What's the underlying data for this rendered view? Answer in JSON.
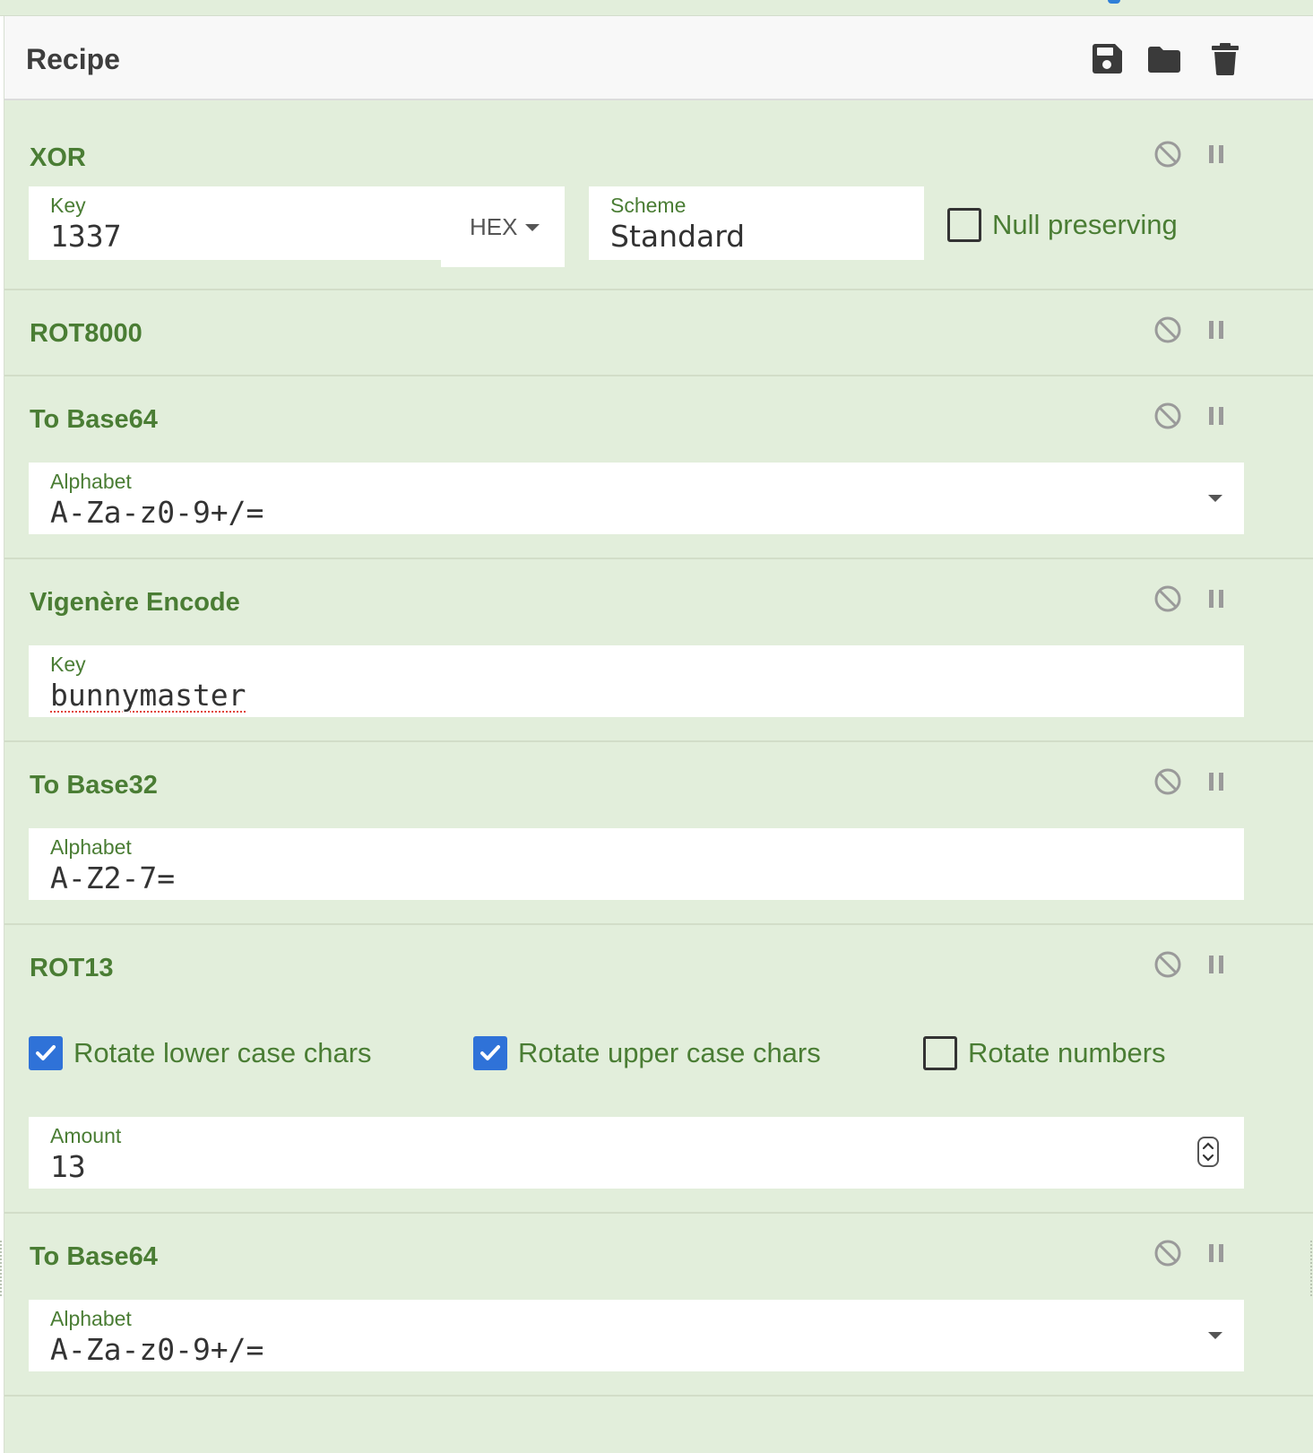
{
  "recipe": {
    "title": "Recipe",
    "actions": [
      {
        "name": "save-icon",
        "label": "Save recipe"
      },
      {
        "name": "folder-icon",
        "label": "Load recipe"
      },
      {
        "name": "trash-icon",
        "label": "Clear recipe"
      }
    ]
  },
  "operations": [
    {
      "name": "XOR",
      "key_label": "Key",
      "key_value": "1337",
      "key_format": "HEX",
      "scheme_label": "Scheme",
      "scheme_value": "Standard",
      "null_preserving_label": "Null preserving",
      "null_preserving_checked": false
    },
    {
      "name": "ROT8000"
    },
    {
      "name": "To Base64",
      "alphabet_label": "Alphabet",
      "alphabet_value": "A-Za-z0-9+/="
    },
    {
      "name": "Vigenère Encode",
      "key_label": "Key",
      "key_value": "bunnymaster"
    },
    {
      "name": "To Base32",
      "alphabet_label": "Alphabet",
      "alphabet_value": "A-Z2-7="
    },
    {
      "name": "ROT13",
      "rotate_lower_label": "Rotate lower case chars",
      "rotate_lower_checked": true,
      "rotate_upper_label": "Rotate upper case chars",
      "rotate_upper_checked": true,
      "rotate_numbers_label": "Rotate numbers",
      "rotate_numbers_checked": false,
      "amount_label": "Amount",
      "amount_value": "13"
    },
    {
      "name": "To Base64",
      "alphabet_label": "Alphabet",
      "alphabet_value": "A-Za-z0-9+/="
    }
  ],
  "colors": {
    "panel_bg": "#e2eedb",
    "op_name": "#4a7d34",
    "checkbox_on": "#2f72d8",
    "icon_dark": "#3a3a3a",
    "icon_light": "#9a9a9a"
  }
}
